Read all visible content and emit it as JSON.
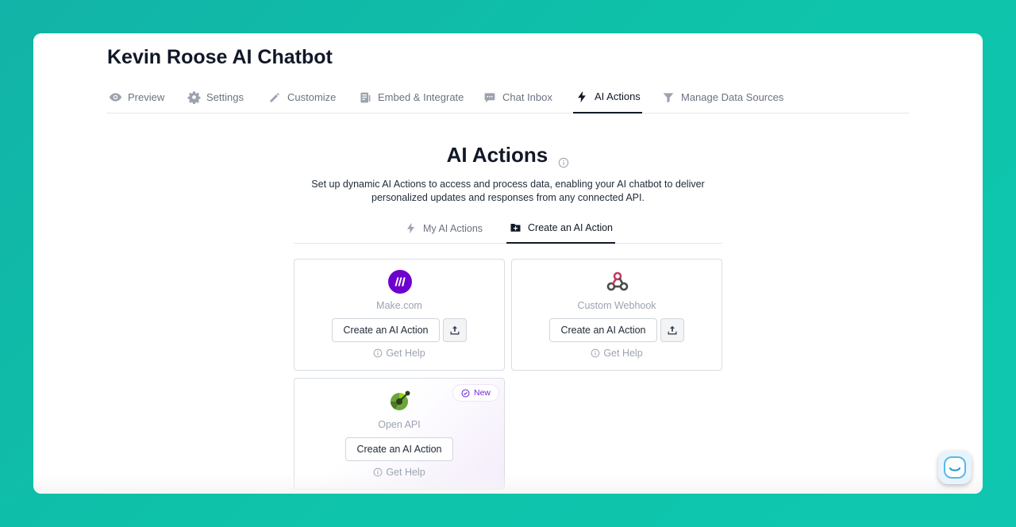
{
  "page": {
    "title": "Kevin Roose AI Chatbot"
  },
  "nav": {
    "items": [
      {
        "label": "Preview",
        "icon": "eye-icon"
      },
      {
        "label": "Settings",
        "icon": "gear-icon"
      },
      {
        "label": "Customize",
        "icon": "pencil-icon"
      },
      {
        "label": "Embed & Integrate",
        "icon": "code-doc-icon"
      },
      {
        "label": "Chat Inbox",
        "icon": "chat-bubble-icon"
      },
      {
        "label": "AI Actions",
        "icon": "lightning-icon",
        "active": true
      },
      {
        "label": "Manage Data Sources",
        "icon": "funnel-icon"
      }
    ]
  },
  "section": {
    "title": "AI Actions",
    "description": "Set up dynamic AI Actions to access and process data, enabling your AI chatbot to deliver personalized updates and responses from any connected API."
  },
  "subtabs": [
    {
      "label": "My AI Actions",
      "icon": "lightning-icon"
    },
    {
      "label": "Create an AI Action",
      "icon": "folder-plus-icon",
      "active": true
    }
  ],
  "cards": [
    {
      "name": "Make.com",
      "button": "Create an AI Action",
      "help": "Get Help",
      "logo": "make-logo",
      "logo_color": "#6d00cc"
    },
    {
      "name": "Custom Webhook",
      "button": "Create an AI Action",
      "help": "Get Help",
      "logo": "webhook-logo",
      "logo_color": "#c73a63"
    },
    {
      "name": "Open API",
      "button": "Create an AI Action",
      "help": "Get Help",
      "logo": "openapi-logo",
      "badge": "New",
      "logo_color": "#6ba539"
    }
  ],
  "colors": {
    "background": "#0ec3a9",
    "accent": "#6d28d9",
    "text": "#111827",
    "muted": "#9ca3af"
  }
}
